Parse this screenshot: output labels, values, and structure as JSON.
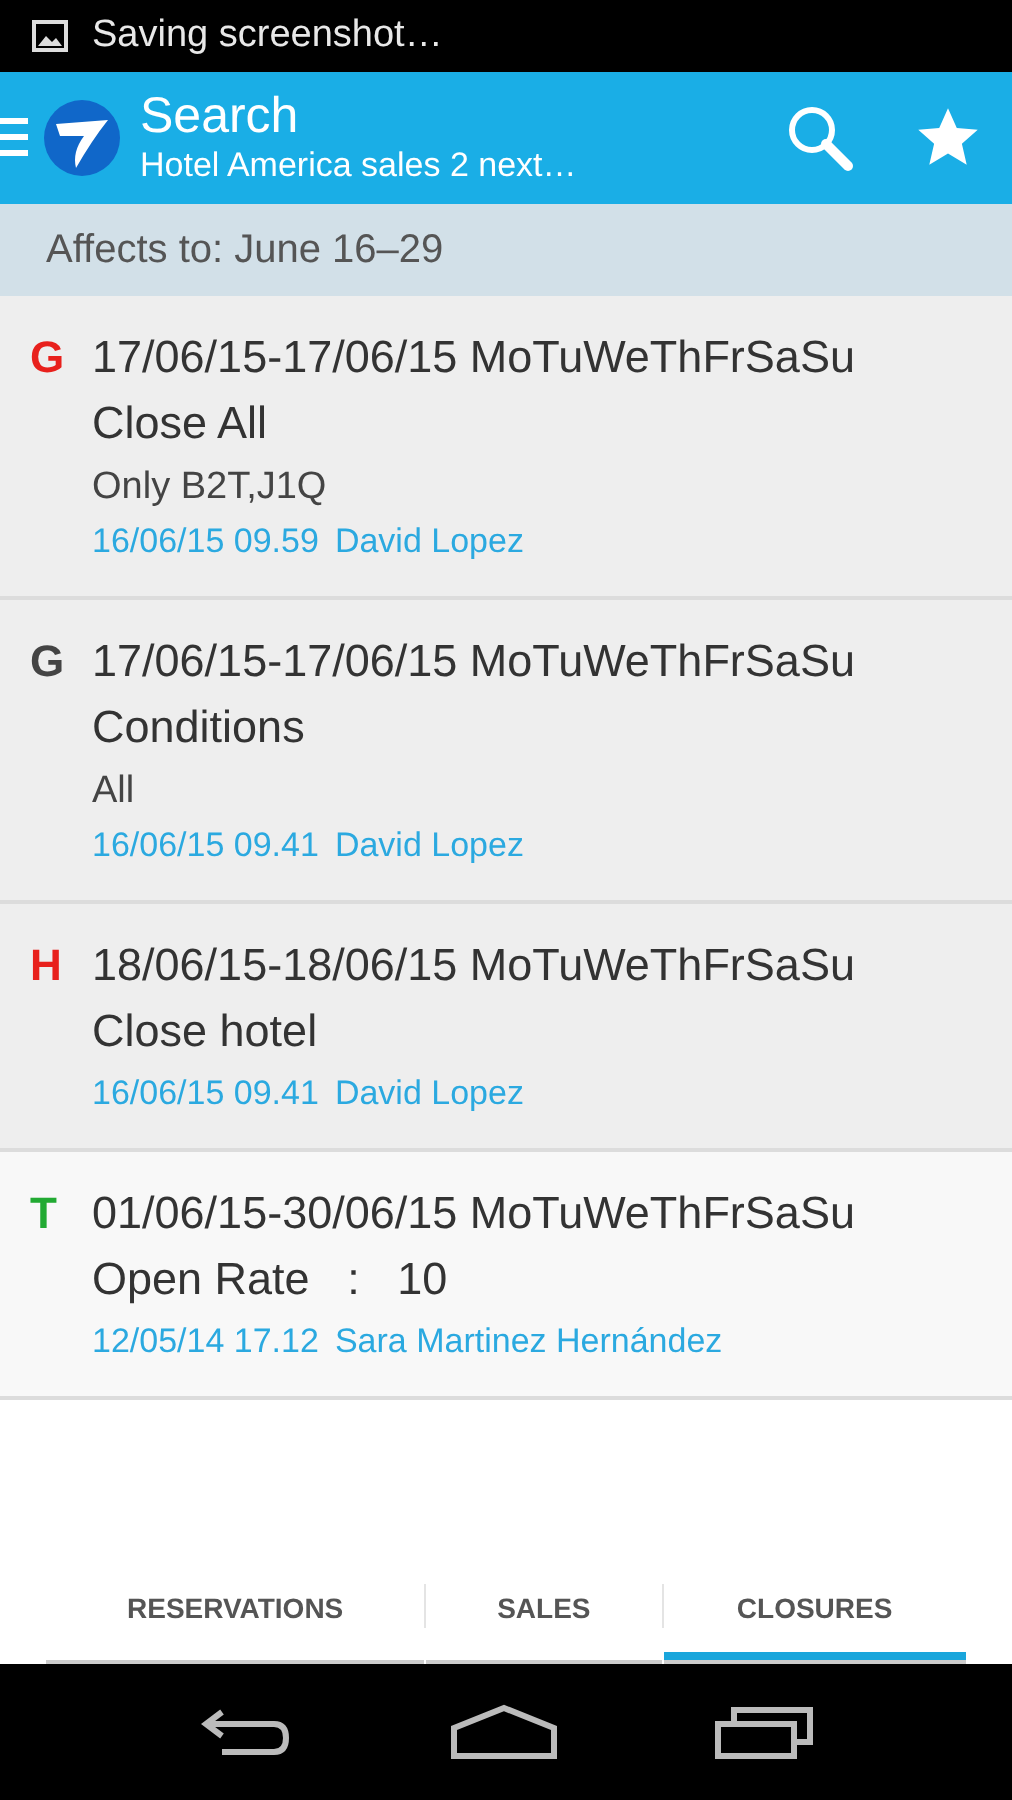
{
  "status_bar": {
    "notification": "Saving screenshot…"
  },
  "app_bar": {
    "title": "Search",
    "subtitle": "Hotel America sales 2 next…"
  },
  "affects": "Affects to: June 16–29",
  "closures": [
    {
      "letter": "G",
      "color": "#e8201c",
      "range": "17/06/15-17/06/15 MoTuWeThFrSaSu",
      "title": "Close All",
      "detail": "Only B2T,J1Q",
      "stamp": "16/06/15 09.59",
      "author": "David Lopez"
    },
    {
      "letter": "G",
      "color": "#444444",
      "range": "17/06/15-17/06/15 MoTuWeThFrSaSu",
      "title": "Conditions",
      "detail": "All",
      "stamp": "16/06/15 09.41",
      "author": "David Lopez"
    },
    {
      "letter": "H",
      "color": "#e8201c",
      "range": "18/06/15-18/06/15 MoTuWeThFrSaSu",
      "title": "Close hotel",
      "stamp": "16/06/15 09.41",
      "author": "David Lopez"
    },
    {
      "letter": "T",
      "color": "#22aa33",
      "range": "01/06/15-30/06/15 MoTuWeThFrSaSu",
      "title": "Open Rate   :   10",
      "stamp": "12/05/14 17.12",
      "author": "Sara Martinez Hernández"
    }
  ],
  "tabs": [
    {
      "label": "RESERVATIONS",
      "selected": false
    },
    {
      "label": "SALES",
      "selected": false
    },
    {
      "label": "CLOSURES",
      "selected": true
    }
  ]
}
